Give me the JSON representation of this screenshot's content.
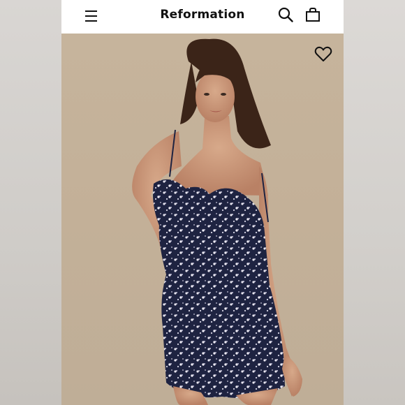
{
  "header": {
    "brand": "Reformation",
    "icons": [
      "menu-icon",
      "search-icon",
      "shopping-bag-icon"
    ]
  },
  "product_image": {
    "favorite_icon": "heart-icon"
  },
  "colors": {
    "page_background": "#d6d3cf",
    "header_background": "#ffffff",
    "photo_background": "#c5b39b",
    "dress": "#1e2341",
    "text": "#111111"
  }
}
